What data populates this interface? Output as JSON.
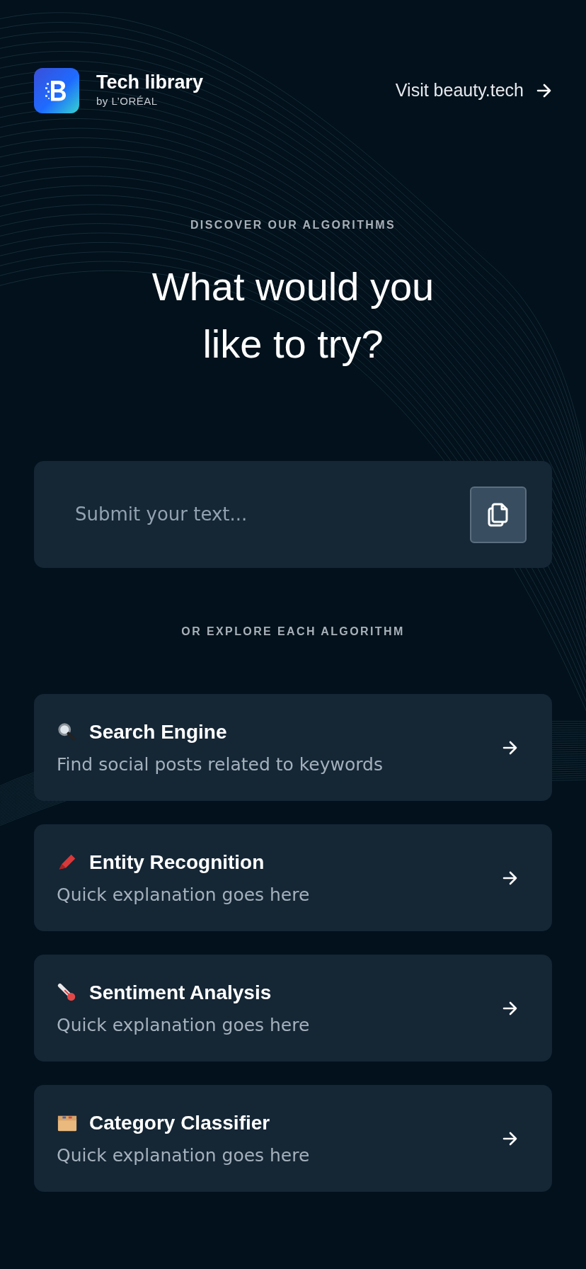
{
  "header": {
    "title": "Tech library",
    "subtitle": "by L’ORÉAL",
    "link": "Visit beauty.tech"
  },
  "hero": {
    "eyebrow": "DISCOVER OUR ALGORITHMS",
    "heading": "What would you like to try?"
  },
  "input": {
    "placeholder": "Submit your text..."
  },
  "section_label": "OR EXPLORE EACH ALGORITHM",
  "algorithms": [
    {
      "title": "Search Engine",
      "description": "Find social posts related to keywords"
    },
    {
      "title": "Entity Recognition",
      "description": "Quick explanation goes here"
    },
    {
      "title": "Sentiment Analysis",
      "description": "Quick explanation goes here"
    },
    {
      "title": "Category Classifier",
      "description": "Quick explanation goes here"
    }
  ]
}
